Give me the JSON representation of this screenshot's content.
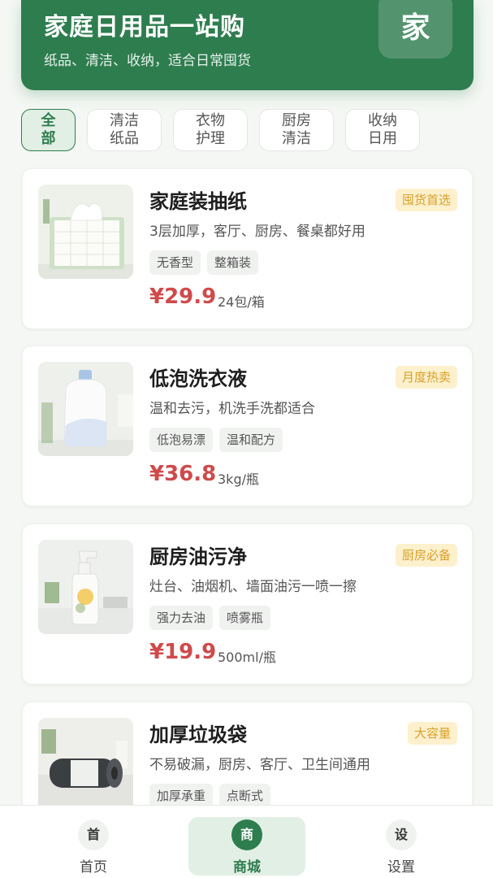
{
  "header": {
    "title": "家庭日用品一站购",
    "subtitle": "纸品、清洁、收纳，适合日常囤货",
    "badge": "家"
  },
  "tabs": [
    {
      "label": "全\n部",
      "active": true
    },
    {
      "label": "清洁\n纸品",
      "active": false
    },
    {
      "label": "衣物\n护理",
      "active": false
    },
    {
      "label": "厨房\n清洁",
      "active": false
    },
    {
      "label": "收纳\n日用",
      "active": false
    }
  ],
  "products": [
    {
      "name": "家庭装抽纸",
      "badge": "囤货首选",
      "desc": "3层加厚，客厅、厨房、餐桌都好用",
      "tags": [
        "无香型",
        "整箱装"
      ],
      "price": "¥29.9",
      "unit": "24包/箱",
      "image_icon": "tissue-box"
    },
    {
      "name": "低泡洗衣液",
      "badge": "月度热卖",
      "desc": "温和去污，机洗手洗都适合",
      "tags": [
        "低泡易漂",
        "温和配方"
      ],
      "price": "¥36.8",
      "unit": "3kg/瓶",
      "image_icon": "detergent-bottle"
    },
    {
      "name": "厨房油污净",
      "badge": "厨房必备",
      "desc": "灶台、油烟机、墙面油污一喷一擦",
      "tags": [
        "强力去油",
        "喷雾瓶"
      ],
      "price": "¥19.9",
      "unit": "500ml/瓶",
      "image_icon": "spray-bottle"
    },
    {
      "name": "加厚垃圾袋",
      "badge": "大容量",
      "desc": "不易破漏，厨房、客厅、卫生间通用",
      "tags": [
        "加厚承重",
        "点断式"
      ],
      "price": "",
      "unit": "",
      "image_icon": "garbage-bag-roll"
    }
  ],
  "bottom_nav": [
    {
      "icon": "首",
      "label": "首页",
      "active": false
    },
    {
      "icon": "商",
      "label": "商城",
      "active": true
    },
    {
      "icon": "设",
      "label": "设置",
      "active": false
    }
  ],
  "colors": {
    "brand_green": "#2e7d4f",
    "price_red": "#cf4a4a",
    "badge_bg": "#fdf0cc",
    "badge_text": "#d8a12a"
  }
}
